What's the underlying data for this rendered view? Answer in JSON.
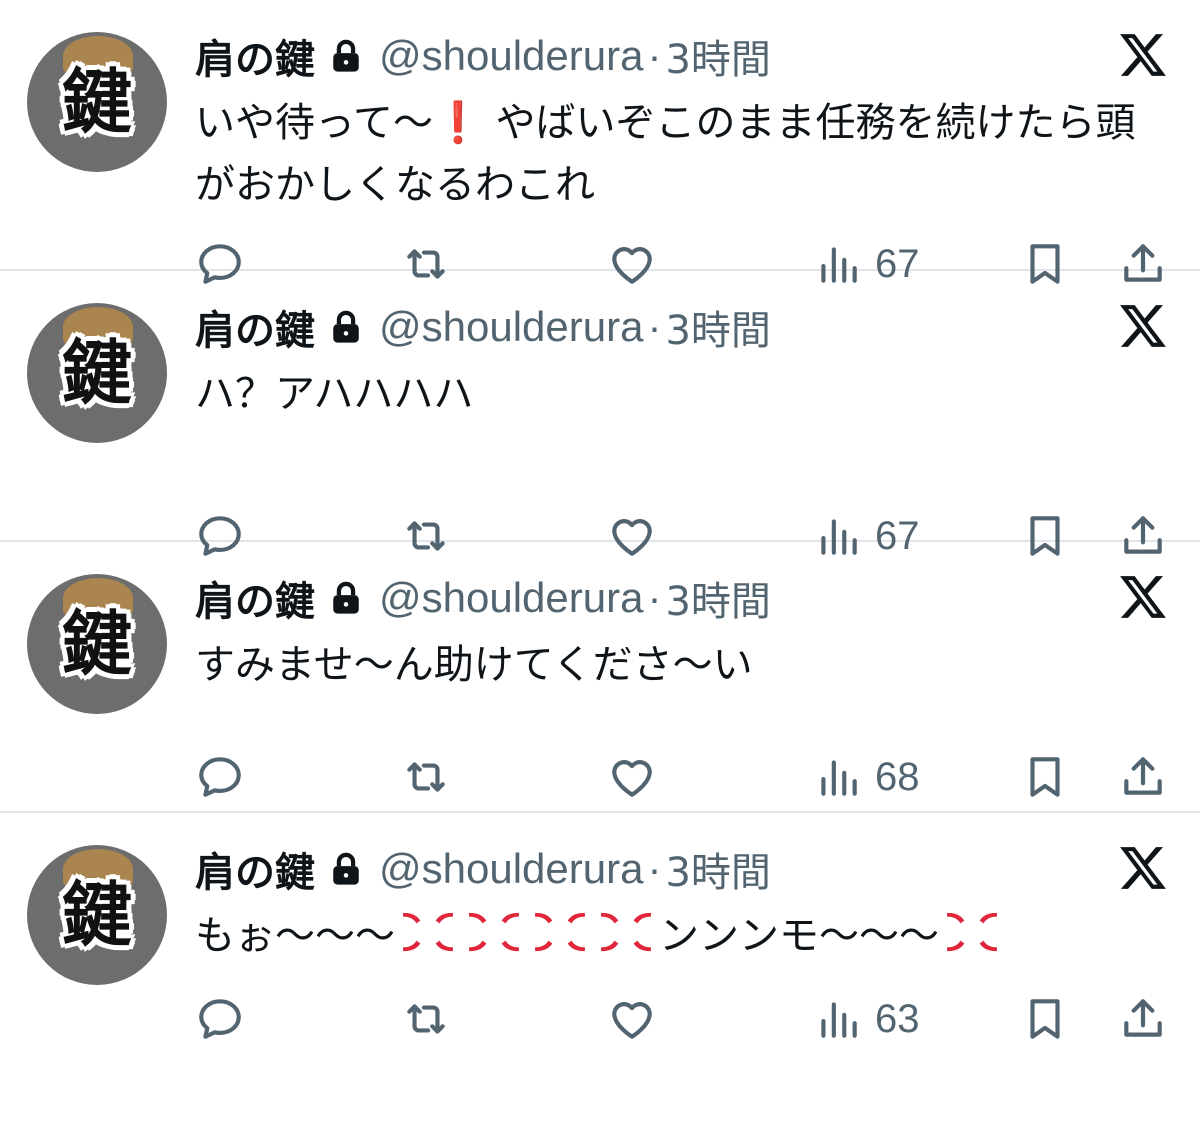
{
  "tweets": [
    {
      "name": "肩の鍵",
      "handle": "@shoulderura",
      "separator": "·",
      "time": "3時間",
      "avatar_char": "鍵",
      "text_parts": [
        "いや待って〜",
        "❗",
        " やばいぞこのまま任務を続けたら頭がおかしくなるわこれ"
      ],
      "views": "67"
    },
    {
      "name": "肩の鍵",
      "handle": "@shoulderura",
      "separator": "·",
      "time": "3時間",
      "avatar_char": "鍵",
      "text": "ハ？アハハハハ",
      "views": "67"
    },
    {
      "name": "肩の鍵",
      "handle": "@shoulderura",
      "separator": "·",
      "time": "3時間",
      "avatar_char": "鍵",
      "text": "すみませ〜ん助けてくださ〜い",
      "views": "68"
    },
    {
      "name": "肩の鍵",
      "handle": "@shoulderura",
      "separator": "·",
      "time": "3時間",
      "avatar_char": "鍵",
      "text_parts": [
        "もぉ〜〜〜",
        "ンンンモ〜〜〜"
      ],
      "anger_emoji": "💢",
      "views": "63"
    }
  ],
  "icons": {
    "reply": "reply-icon",
    "retweet": "retweet-icon",
    "like": "heart-icon",
    "views": "views-icon",
    "bookmark": "bookmark-icon",
    "share": "share-icon",
    "lock": "lock-icon",
    "x_logo": "x-logo-icon"
  },
  "colors": {
    "text": "#0f1419",
    "secondary": "#536471",
    "divider": "#e1e4e8",
    "anger": "#e0263a"
  }
}
